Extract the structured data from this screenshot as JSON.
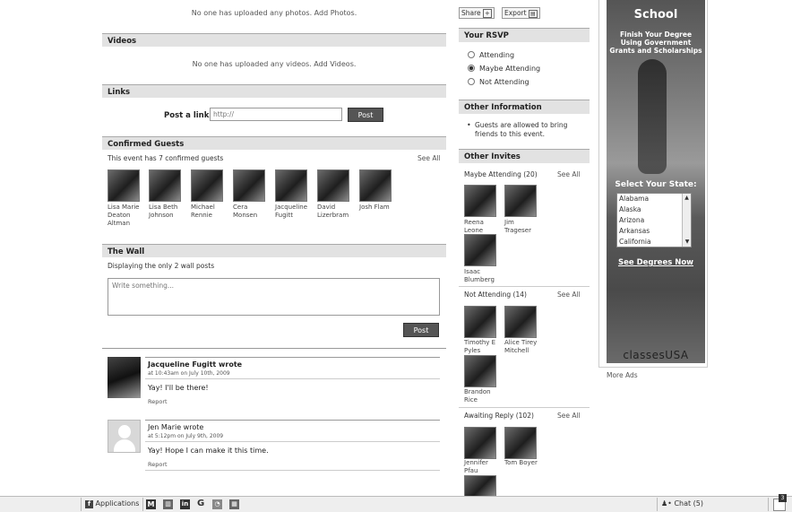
{
  "photos": {
    "empty": "No one has uploaded any photos. Add Photos."
  },
  "videos": {
    "title": "Videos",
    "empty": "No one has uploaded any videos. Add Videos."
  },
  "links": {
    "title": "Links",
    "label": "Post a link:",
    "placeholder": "http://",
    "button": "Post"
  },
  "guests": {
    "title": "Confirmed Guests",
    "summary": "This event has 7 confirmed guests",
    "see_all": "See All",
    "people": [
      "Lisa Marie Deaton Altman",
      "Lisa Beth Johnson",
      "Michael Rennie",
      "Cera Monsen",
      "Jacqueline Fugitt",
      "David Lizerbram",
      "Josh Flam"
    ]
  },
  "wall": {
    "title": "The Wall",
    "summary": "Displaying the only 2 wall posts",
    "placeholder": "Write something...",
    "button": "Post",
    "posts": [
      {
        "author": "Jacqueline Fugitt wrote",
        "time": "at 10:43am on July 10th, 2009",
        "text": "Yay! I'll be there!",
        "report": "Report"
      },
      {
        "author": "Jen Marie wrote",
        "time": "at 5:12pm on July 9th, 2009",
        "text": "Yay! Hope I can make it this time.",
        "report": "Report"
      }
    ]
  },
  "toolbar": {
    "share": "Share",
    "export": "Export"
  },
  "rsvp": {
    "title": "Your RSVP",
    "options": [
      "Attending",
      "Maybe Attending",
      "Not Attending"
    ],
    "selected": "Maybe Attending"
  },
  "info": {
    "title": "Other Information",
    "bullet": "Guests are allowed to bring friends to this event."
  },
  "invites": {
    "title": "Other Invites",
    "maybe": {
      "label": "Maybe Attending (20)",
      "see_all": "See All",
      "people": [
        "Reena Leone",
        "Jim Trageser",
        "Isaac Blumberg"
      ]
    },
    "not": {
      "label": "Not Attending (14)",
      "see_all": "See All",
      "people": [
        "Timothy E Pyles",
        "Alice Tirey Mitchell",
        "Brandon Rice"
      ]
    },
    "awaiting": {
      "label": "Awaiting Reply (102)",
      "see_all": "See All",
      "people": [
        "Jennifer Pfau",
        "Tom Boyer"
      ]
    }
  },
  "ad": {
    "heading": "School",
    "tagline": "Finish Your Degree Using Government Grants and Scholarships",
    "state_label": "Select Your State:",
    "states": [
      "Alabama",
      "Alaska",
      "Arizona",
      "Arkansas",
      "California"
    ],
    "link": "See Degrees Now",
    "brand": "classesUSA",
    "more": "More Ads"
  },
  "bottombar": {
    "applications": "Applications",
    "chat": "Chat (5)",
    "notif_count": "3"
  }
}
